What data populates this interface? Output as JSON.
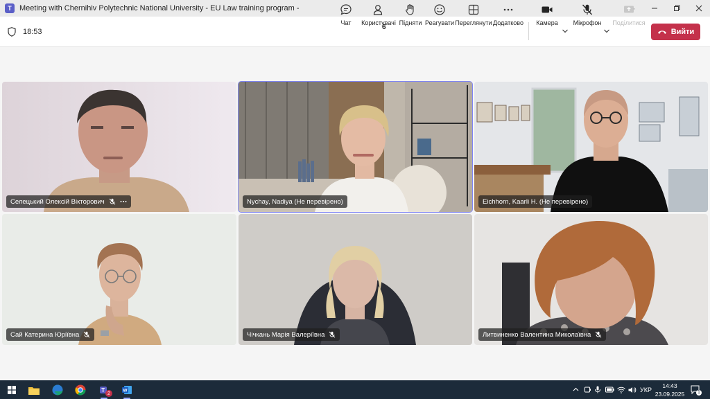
{
  "window": {
    "title": "Meeting with Chernihiv Polytechnic National University - EU Law training program -",
    "more": "···"
  },
  "toolbar": {
    "time": "18:53",
    "participants_count": "6",
    "buttons": {
      "chat": "Чат",
      "people": "Користувачі",
      "raise": "Підняти",
      "react": "Реагувати",
      "view": "Переглянути",
      "more": "Додатково",
      "camera": "Камера",
      "mic": "Мікрофон",
      "share": "Поділитися"
    },
    "leave": "Вийти"
  },
  "participants": [
    {
      "name": "Селецький Олексій Вікторович",
      "muted": true
    },
    {
      "name": "Nychay, Nadiya (Не перевірено)",
      "muted": false
    },
    {
      "name": "Eichhorn, Kaarli H. (Не перевірено)",
      "muted": false
    },
    {
      "name": "Сай Катерина Юріївна",
      "muted": true
    },
    {
      "name": "Чічкань Марія Валеріївна",
      "muted": true
    },
    {
      "name": "Литвиненко Валентина Миколаївна",
      "muted": true
    }
  ],
  "taskbar": {
    "teams_badge": "2",
    "lang": "УКР",
    "time": "14:43",
    "date": "23.09.2025",
    "notif_count": "1"
  },
  "colors": {
    "accent": "#5b5fc7",
    "leave": "#c4314b",
    "active_border": "#7f85f5",
    "taskbar": "#1c2b3a"
  }
}
